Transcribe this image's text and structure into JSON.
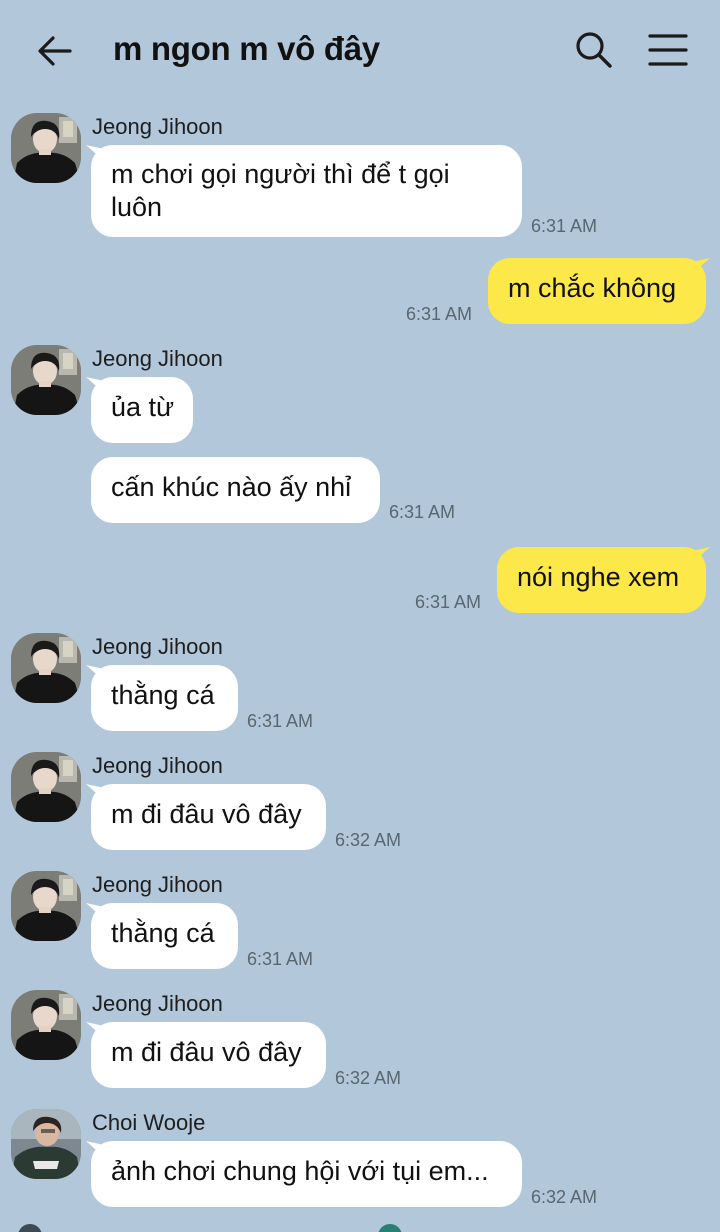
{
  "header": {
    "title": "m ngon m vô đây"
  },
  "colors": {
    "background": "#b2c7da",
    "incoming_bubble": "#ffffff",
    "outgoing_bubble": "#fde84a"
  },
  "icons": [
    "back-arrow-icon",
    "search-icon",
    "menu-icon"
  ],
  "messages": [
    {
      "sender": "Jeong Jihoon",
      "text": "m chơi gọi người thì để t gọi luôn",
      "time": "6:31 AM"
    },
    {
      "sender": "me",
      "text": "m chắc không",
      "time": "6:31 AM"
    },
    {
      "sender": "Jeong Jihoon",
      "text": "ủa từ",
      "time": ""
    },
    {
      "sender": "Jeong Jihoon",
      "text": "cấn khúc nào ấy nhỉ",
      "time": "6:31 AM"
    },
    {
      "sender": "me",
      "text": "nói nghe xem",
      "time": "6:31 AM"
    },
    {
      "sender": "Jeong Jihoon",
      "text": "thằng cá",
      "time": "6:31 AM"
    },
    {
      "sender": "Jeong Jihoon",
      "text": "m đi đâu vô đây",
      "time": "6:32 AM"
    },
    {
      "sender": "Jeong Jihoon",
      "text": "thằng cá",
      "time": "6:31 AM"
    },
    {
      "sender": "Jeong Jihoon",
      "text": "m đi đâu vô đây",
      "time": "6:32 AM"
    },
    {
      "sender": "Choi Wooje",
      "text": "ảnh chơi chung hội với tụi em...",
      "time": "6:32 AM"
    }
  ]
}
